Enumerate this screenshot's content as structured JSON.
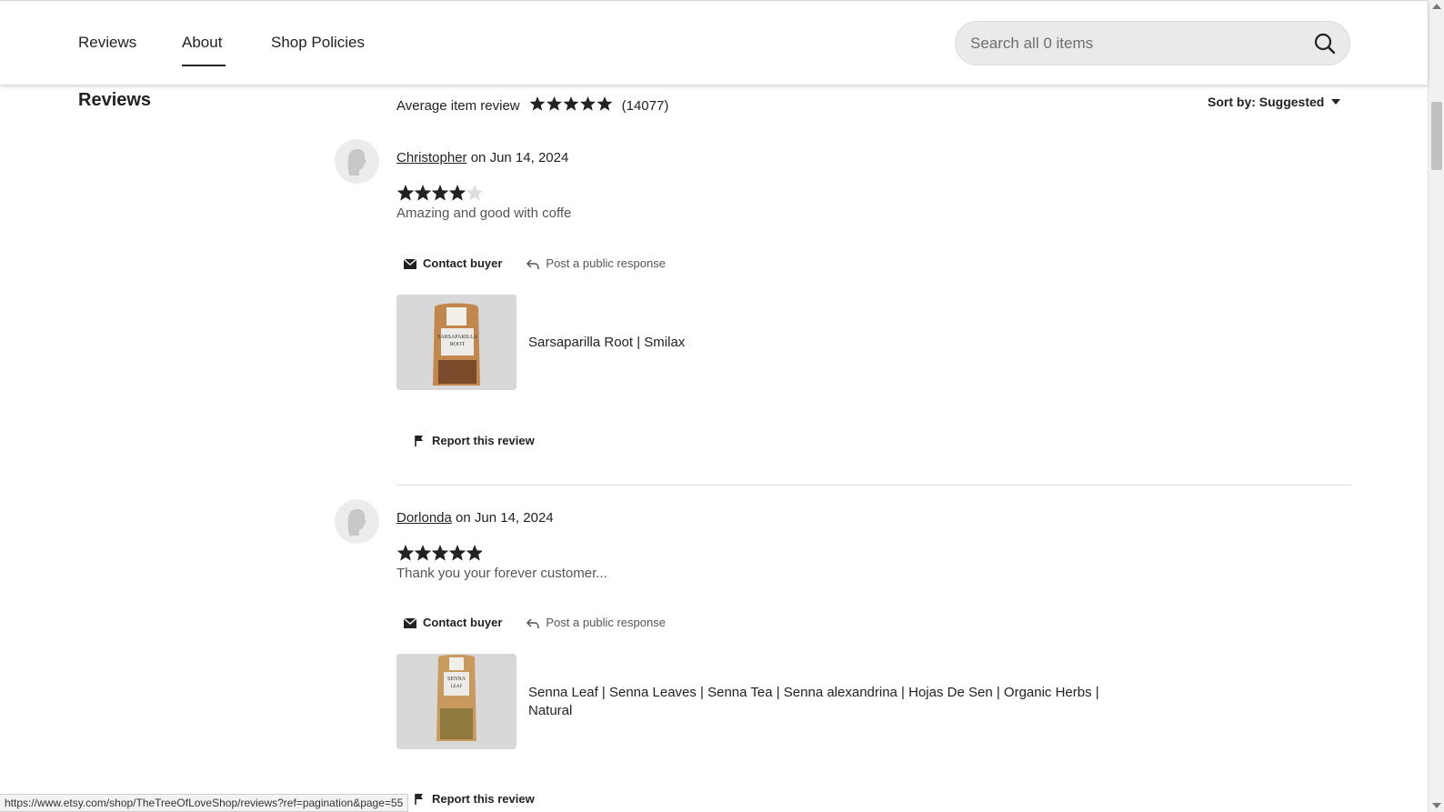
{
  "nav": {
    "tabs": [
      {
        "label": "Reviews"
      },
      {
        "label": "About"
      },
      {
        "label": "Shop Policies"
      }
    ],
    "active_tab": "About",
    "search": {
      "placeholder": "Search all 0 items",
      "icon": "search-icon"
    }
  },
  "section": {
    "title": "Reviews",
    "average_label": "Average item review",
    "average_rating": 5,
    "review_count": "(14077)",
    "sort_label": "Sort by: Suggested"
  },
  "reviews": [
    {
      "reviewer": "Christopher",
      "date_text": "on Jun 14, 2024",
      "rating": 4,
      "text": "Amazing and good with coffe",
      "contact_label": "Contact buyer",
      "respond_label": "Post a public response",
      "product_title": "Sarsaparilla Root | Smilax",
      "product_label_line1": "SARSAPARILLA",
      "product_label_line2": "ROOT",
      "report_label": "Report this review"
    },
    {
      "reviewer": "Dorlonda",
      "date_text": "on Jun 14, 2024",
      "rating": 5,
      "text": "Thank you your forever customer...",
      "contact_label": "Contact buyer",
      "respond_label": "Post a public response",
      "product_title_line1": "Senna Leaf | Senna Leaves | Senna Tea | Senna alexandrina | Hojas De Sen | Organic Herbs |",
      "product_title_line2": "Natural",
      "product_label_line1": "SENNA",
      "product_label_line2": "LEAF",
      "report_label": "Report this review"
    }
  ],
  "status_bar": {
    "url": "https://www.etsy.com/shop/TheTreeOfLoveShop/reviews?ref=pagination&page=55"
  },
  "colors": {
    "star": "#222222",
    "star_empty": "#dddddd",
    "text_muted": "#555555"
  }
}
